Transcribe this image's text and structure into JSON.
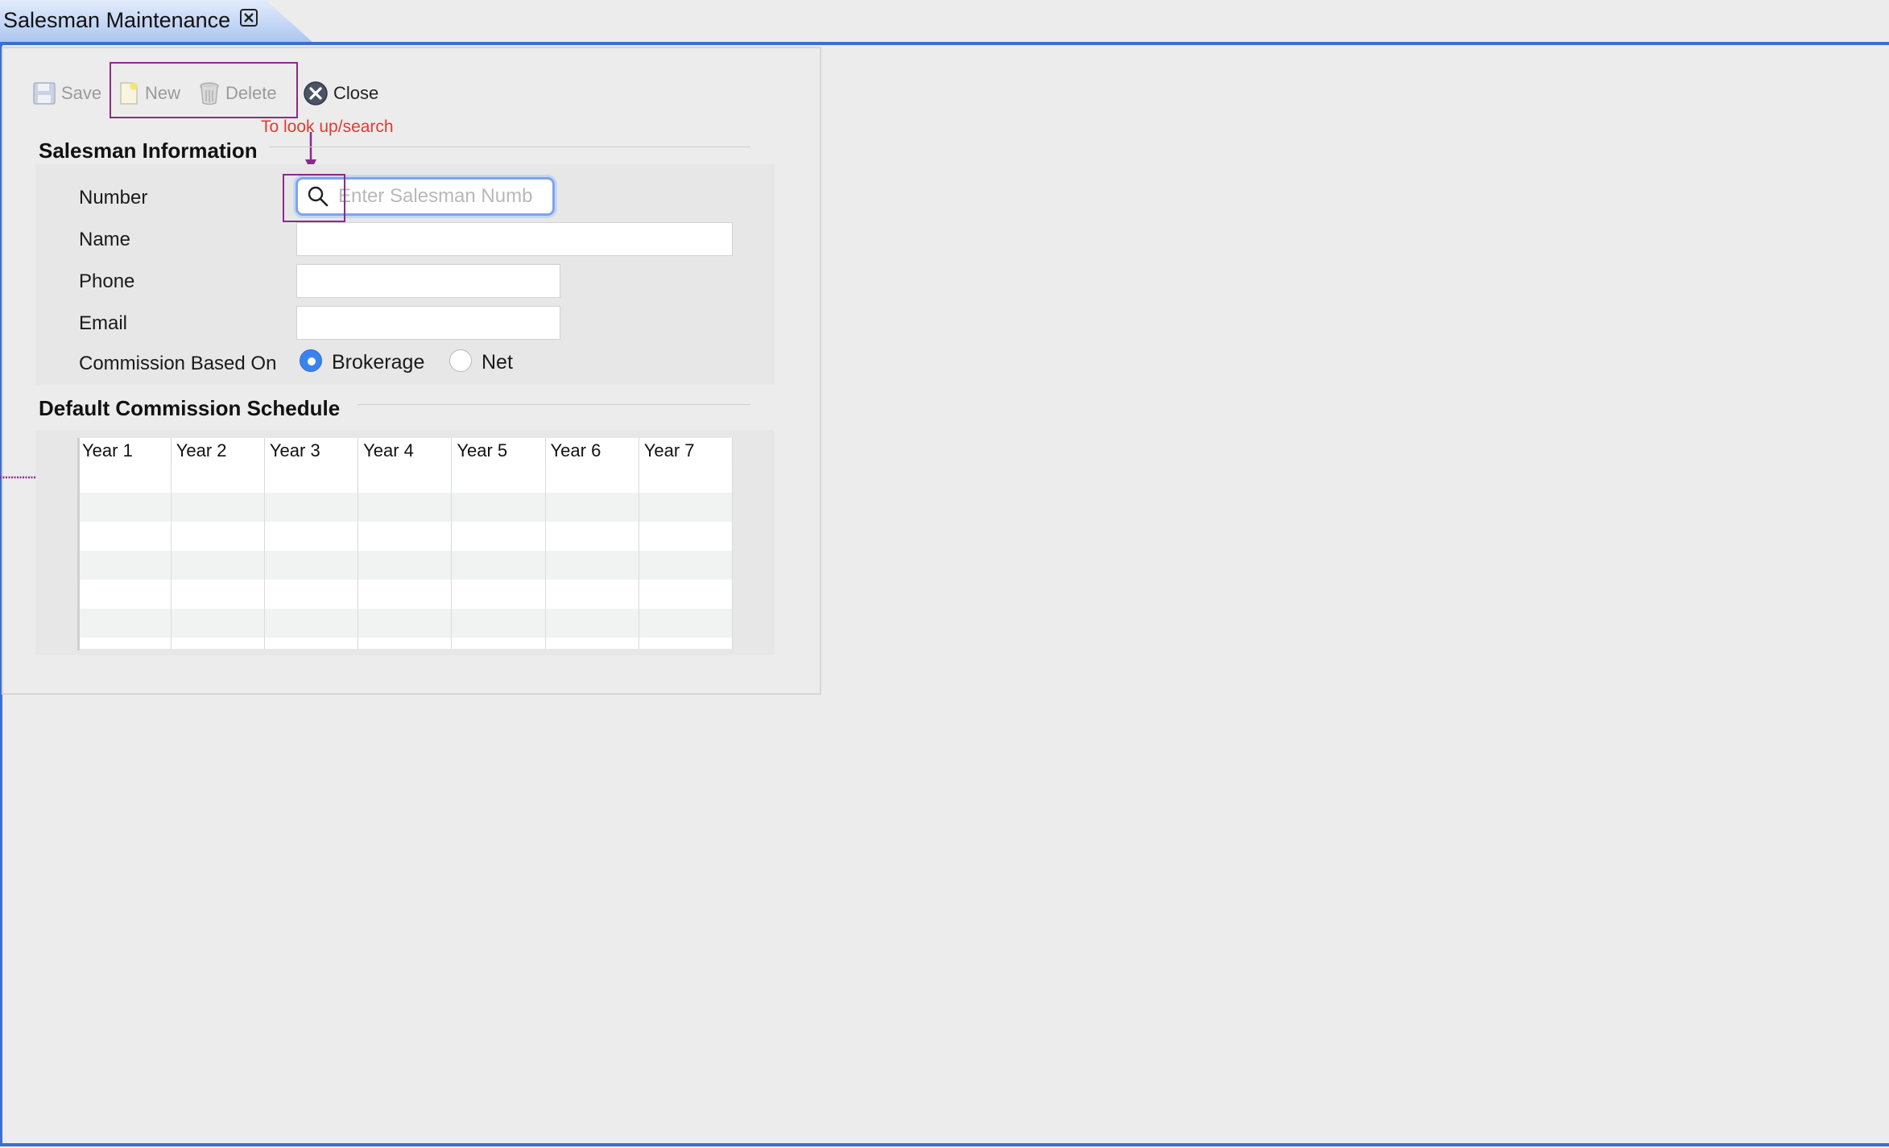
{
  "window": {
    "tab_title": "Salesman Maintenance"
  },
  "toolbar": {
    "save_label": "Save",
    "new_label": "New",
    "delete_label": "Delete",
    "close_label": "Close"
  },
  "annotation": {
    "lookup_note": "To look up/search"
  },
  "salesman_info": {
    "title": "Salesman Information",
    "number_label": "Number",
    "number_placeholder": "Enter Salesman Numb",
    "number_value": "",
    "name_label": "Name",
    "name_value": "",
    "phone_label": "Phone",
    "phone_value": "",
    "email_label": "Email",
    "email_value": "",
    "commission_label": "Commission Based On",
    "commission_options": [
      "Brokerage",
      "Net"
    ],
    "commission_selected": "Brokerage"
  },
  "schedule": {
    "title": "Default Commission Schedule",
    "columns": [
      "Year 1",
      "Year 2",
      "Year 3",
      "Year 4",
      "Year 5",
      "Year 6",
      "Year 7"
    ],
    "rows": [
      [
        "",
        "",
        "",
        "",
        "",
        "",
        ""
      ],
      [
        "",
        "",
        "",
        "",
        "",
        "",
        ""
      ],
      [
        "",
        "",
        "",
        "",
        "",
        "",
        ""
      ],
      [
        "",
        "",
        "",
        "",
        "",
        "",
        ""
      ],
      [
        "",
        "",
        "",
        "",
        "",
        "",
        ""
      ],
      [
        "",
        "",
        "",
        "",
        "",
        "",
        ""
      ]
    ]
  },
  "colors": {
    "accent": "#3b6fd1",
    "annotation_box": "#8b2a8e",
    "annotation_text": "#e23b2e",
    "radio_selected": "#3a82f0"
  },
  "icons": {
    "save": "save-icon",
    "new": "new-document-icon",
    "delete": "trash-icon",
    "close": "close-circle-icon",
    "tab_close": "close-tab-icon",
    "search": "search-icon"
  }
}
